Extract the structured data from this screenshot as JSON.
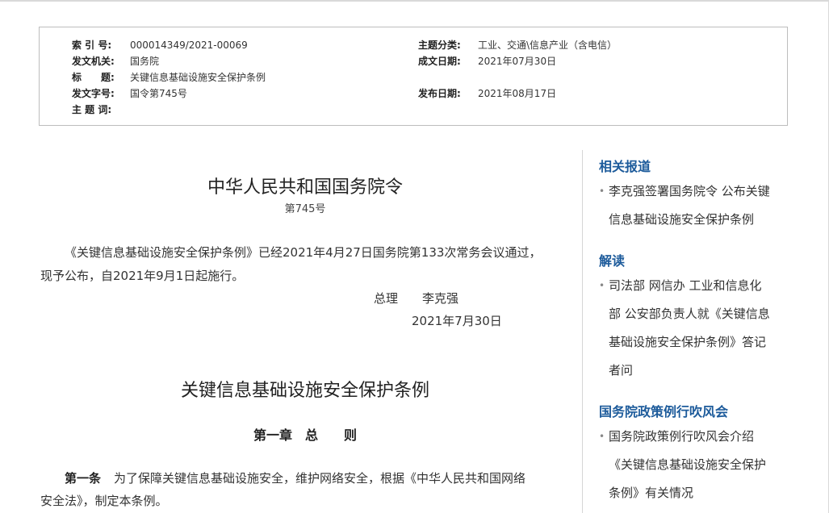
{
  "meta": {
    "index_label": "索 引 号:",
    "index_value": "000014349/2021-00069",
    "topic_label": "主题分类:",
    "topic_value": "工业、交通\\信息产业（含电信）",
    "issuer_label": "发文机关:",
    "issuer_value": "国务院",
    "written_label": "成文日期:",
    "written_value": "2021年07月30日",
    "title_label": "标　　题:",
    "title_value": "关键信息基础设施安全保护条例",
    "docno_label": "发文字号:",
    "docno_value": "国令第745号",
    "publish_label": "发布日期:",
    "publish_value": "2021年08月17日",
    "subject_label": "主 题 词:",
    "subject_value": ""
  },
  "article": {
    "order_title": "中华人民共和国国务院令",
    "order_number": "第745号",
    "intro_line1": "《关键信息基础设施安全保护条例》已经2021年4月27日国务院第133次常务会议通过，",
    "intro_line2": "现予公布，自2021年9月1日起施行。",
    "signer": "总理　　李克强",
    "sign_date": "2021年7月30日",
    "reg_title": "关键信息基础设施安全保护条例",
    "chapter": "第一章　总　　则",
    "art1_label": "第一条",
    "art1_line1": "为了保障关键信息基础设施安全，维护网络安全，根据《中华人民共和国网络",
    "art1_line2": "安全法》，制定本条例。"
  },
  "sidebar": {
    "sections": [
      {
        "heading": "相关报道",
        "items": [
          {
            "lines": [
              "李克强签署国务院令 公布关键",
              "信息基础设施安全保护条例"
            ]
          }
        ]
      },
      {
        "heading": "解读",
        "items": [
          {
            "lines": [
              "司法部 网信办 工业和信息化",
              "部 公安部负责人就《关键信息",
              "基础设施安全保护条例》答记",
              "者问"
            ]
          }
        ]
      },
      {
        "heading": "国务院政策例行吹风会",
        "items": [
          {
            "lines": [
              "国务院政策例行吹风会介绍",
              "《关键信息基础设施安全保护",
              "条例》有关情况"
            ]
          }
        ]
      }
    ],
    "bullet": "•"
  },
  "colors": {
    "sidebar_heading": "#1d5b9b",
    "border": "#bdbdbd"
  }
}
